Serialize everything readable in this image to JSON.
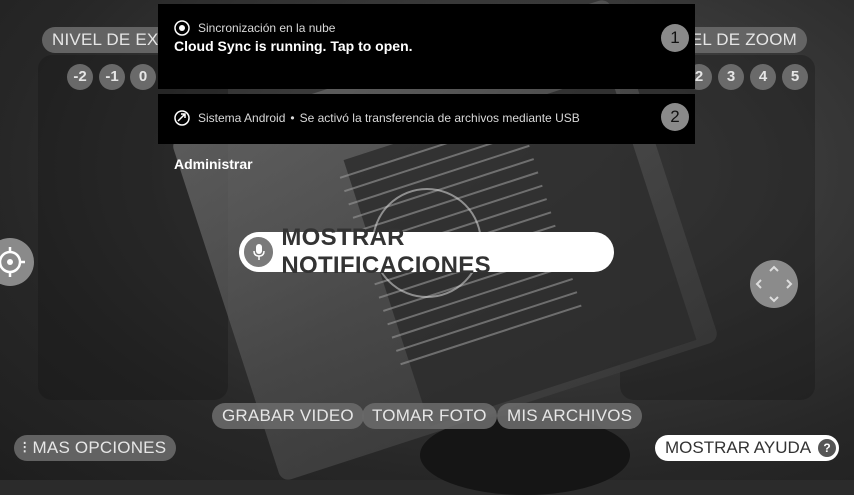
{
  "top_controls": {
    "exposure_label": "NIVEL DE EXPOSICIÓN",
    "exposure_values": [
      "-2",
      "-1",
      "0"
    ],
    "zoom_label": "NIVEL DE ZOOM",
    "zoom_values": [
      "2",
      "3",
      "4",
      "5"
    ]
  },
  "notifications": [
    {
      "app_name": "Sincronización en la nube",
      "title": "Cloud Sync is running. Tap to open.",
      "number": "1"
    },
    {
      "app_name": "Sistema Android",
      "separator": "•",
      "text": "Se activó la transferencia de archivos mediante USB",
      "number": "2",
      "action": "Administrar"
    }
  ],
  "voice_command": {
    "label": "MOSTRAR NOTIFICACIONES"
  },
  "bottom_bar": {
    "record_video": "GRABAR VIDEO",
    "take_photo": "TOMAR FOTO",
    "my_files": "MIS ARCHIVOS",
    "more_options": "MAS OPCIONES",
    "show_help": "MOSTRAR AYUDA",
    "help_glyph": "?",
    "more_glyph": "⁝"
  },
  "colors": {
    "pill_bg": "#696969",
    "notification_bg": "#000000",
    "voice_pill_bg": "#ffffff"
  }
}
